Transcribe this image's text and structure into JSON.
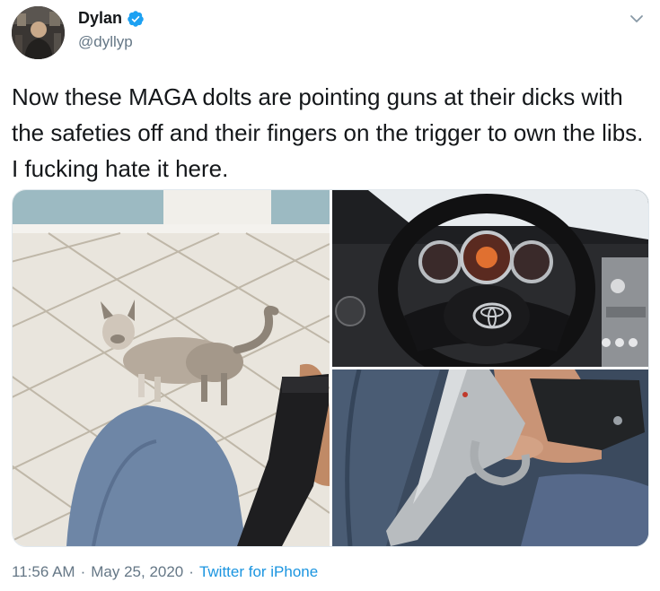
{
  "user": {
    "display_name": "Dylan",
    "handle": "@dyllyp",
    "verified": true,
    "verified_icon": "verified-badge-icon"
  },
  "tweet": {
    "text": "Now these MAGA dolts are pointing guns at their dicks with the safeties off and their fingers on the trigger to own the libs. I fucking hate it here."
  },
  "media": [
    {
      "name": "photo-cat-with-pistol"
    },
    {
      "name": "photo-toyota-steering-wheel"
    },
    {
      "name": "photo-silver-pistol-in-hand"
    }
  ],
  "meta": {
    "time": "11:56 AM",
    "separator": "·",
    "date": "May 25, 2020",
    "source": "Twitter for iPhone"
  },
  "colors": {
    "text": "#14171a",
    "secondary": "#657786",
    "link": "#1b95e0",
    "verified": "#1da1f2"
  }
}
